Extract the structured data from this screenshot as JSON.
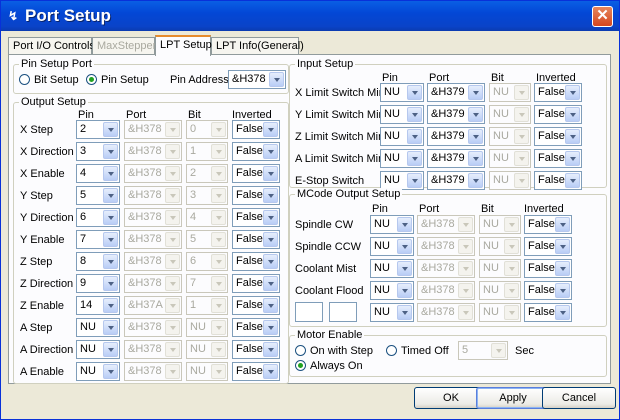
{
  "window": {
    "title": "Port Setup",
    "close": "✕",
    "icon": "↯"
  },
  "tabs": [
    {
      "label": "Port I/O Controls",
      "state": "normal"
    },
    {
      "label": "MaxStepper",
      "state": "disabled"
    },
    {
      "label": "LPT Setup",
      "state": "active"
    },
    {
      "label": "LPT Info(General)",
      "state": "normal"
    }
  ],
  "pin_setup_port": {
    "legend": "Pin Setup Port",
    "bit_setup": "Bit Setup",
    "pin_setup": "Pin Setup",
    "selected": "Pin Setup",
    "pin_address_label": "Pin Address",
    "pin_address_value": "&H378"
  },
  "output_setup": {
    "legend": "Output Setup",
    "headers": {
      "pin": "Pin",
      "port": "Port",
      "bit": "Bit",
      "inverted": "Inverted"
    },
    "rows": [
      {
        "label": "X Step",
        "pin": "2",
        "port": "&H378",
        "bit": "0",
        "inverted": "False"
      },
      {
        "label": "X Direction",
        "pin": "3",
        "port": "&H378",
        "bit": "1",
        "inverted": "False"
      },
      {
        "label": "X Enable",
        "pin": "4",
        "port": "&H378",
        "bit": "2",
        "inverted": "False"
      },
      {
        "label": "Y Step",
        "pin": "5",
        "port": "&H378",
        "bit": "3",
        "inverted": "False"
      },
      {
        "label": "Y Direction",
        "pin": "6",
        "port": "&H378",
        "bit": "4",
        "inverted": "False"
      },
      {
        "label": "Y Enable",
        "pin": "7",
        "port": "&H378",
        "bit": "5",
        "inverted": "False"
      },
      {
        "label": "Z Step",
        "pin": "8",
        "port": "&H378",
        "bit": "6",
        "inverted": "False"
      },
      {
        "label": "Z Direction",
        "pin": "9",
        "port": "&H378",
        "bit": "7",
        "inverted": "False"
      },
      {
        "label": "Z Enable",
        "pin": "14",
        "port": "&H37A",
        "bit": "1",
        "inverted": "False"
      },
      {
        "label": "A Step",
        "pin": "NU",
        "port": "&H378",
        "bit": "NU",
        "inverted": "False"
      },
      {
        "label": "A Direction",
        "pin": "NU",
        "port": "&H378",
        "bit": "NU",
        "inverted": "False"
      },
      {
        "label": "A Enable",
        "pin": "NU",
        "port": "&H378",
        "bit": "NU",
        "inverted": "False"
      }
    ]
  },
  "input_setup": {
    "legend": "Input Setup",
    "headers": {
      "pin": "Pin",
      "port": "Port",
      "bit": "Bit",
      "inverted": "Inverted"
    },
    "rows": [
      {
        "label": "X Limit Switch Min",
        "pin": "NU",
        "port": "&H379",
        "bit": "NU",
        "inverted": "False"
      },
      {
        "label": "Y Limit Switch Min",
        "pin": "NU",
        "port": "&H379",
        "bit": "NU",
        "inverted": "False"
      },
      {
        "label": "Z Limit Switch Min",
        "pin": "NU",
        "port": "&H379",
        "bit": "NU",
        "inverted": "False"
      },
      {
        "label": "A Limit Switch Min",
        "pin": "NU",
        "port": "&H379",
        "bit": "NU",
        "inverted": "False"
      },
      {
        "label": "E-Stop Switch",
        "pin": "NU",
        "port": "&H379",
        "bit": "NU",
        "inverted": "False"
      }
    ]
  },
  "mcode_output_setup": {
    "legend": "MCode Output Setup",
    "headers": {
      "pin": "Pin",
      "port": "Port",
      "bit": "Bit",
      "inverted": "Inverted"
    },
    "rows": [
      {
        "label": "Spindle CW",
        "pin": "NU",
        "port": "&H378",
        "bit": "NU",
        "inverted": "False"
      },
      {
        "label": "Spindle CCW",
        "pin": "NU",
        "port": "&H378",
        "bit": "NU",
        "inverted": "False"
      },
      {
        "label": "Coolant Mist",
        "pin": "NU",
        "port": "&H378",
        "bit": "NU",
        "inverted": "False"
      },
      {
        "label": "Coolant Flood",
        "pin": "NU",
        "port": "&H378",
        "bit": "NU",
        "inverted": "False"
      },
      {
        "label": "",
        "pin": "NU",
        "port": "&H378",
        "bit": "NU",
        "inverted": "False"
      }
    ]
  },
  "motor_enable": {
    "legend": "Motor Enable",
    "on_with_step": "On with Step",
    "timed_off": "Timed Off",
    "always_on": "Always On",
    "selected": "Always On",
    "timed_value": "5",
    "sec_label": "Sec"
  },
  "buttons": {
    "ok": "OK",
    "apply": "Apply",
    "cancel": "Cancel"
  }
}
